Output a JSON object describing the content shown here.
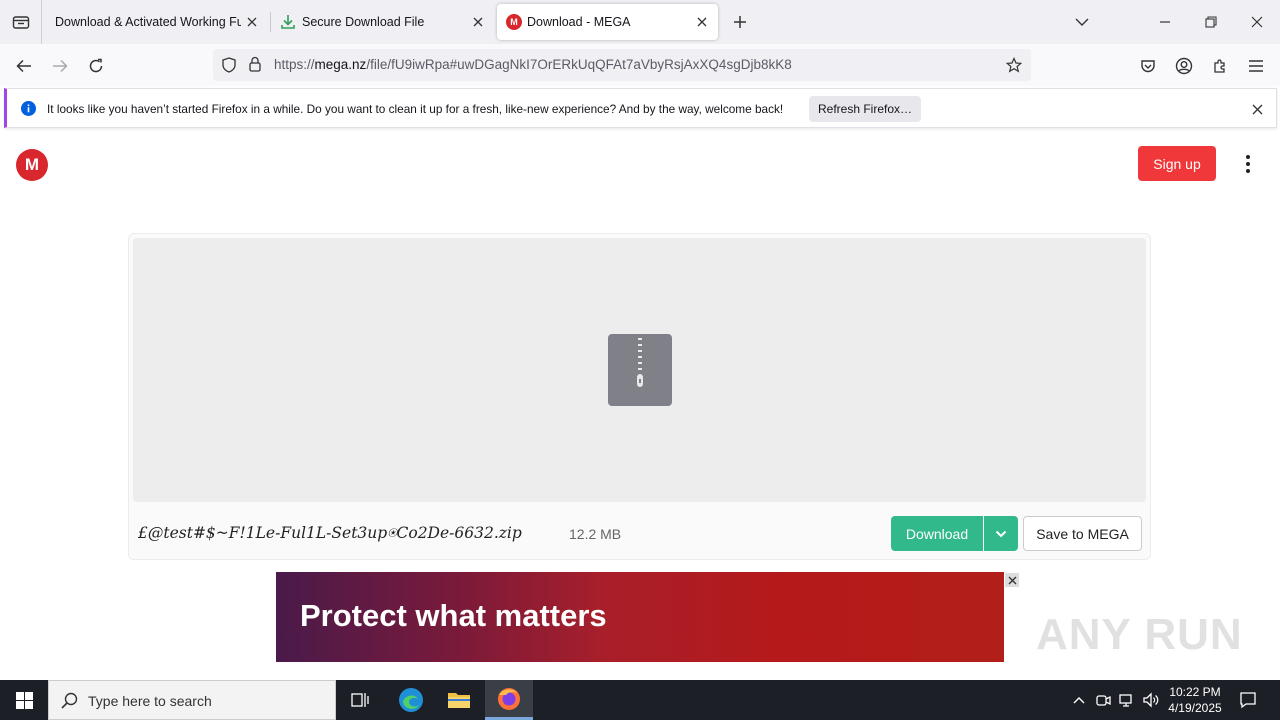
{
  "browser": {
    "tabs": [
      {
        "title": "Download & Activated Working Full"
      },
      {
        "title": "Secure Download File"
      },
      {
        "title": "Download - MEGA"
      }
    ],
    "url": {
      "prefix": "https://",
      "host": "mega.nz",
      "path": "/file/fU9iwRpa#uwDGagNkI7OrERkUqQFAt7aVbyRsjAxXQ4sgDjb8kK8"
    }
  },
  "notification": {
    "text": "It looks like you haven’t started Firefox in a while. Do you want to clean it up for a fresh, like-new experience? And by the way, welcome back!",
    "button": "Refresh Firefox…"
  },
  "page": {
    "logo_letter": "M",
    "signup_label": "Sign up",
    "file": {
      "name": "£@test#$~F!1Le-Ful1L-Set3up⍟Co2De-6632.zip",
      "size": "12.2 MB"
    },
    "download_label": "Download",
    "save_label": "Save to MEGA",
    "ad_text": "Protect what matters",
    "watermark": "ANY RUN"
  },
  "taskbar": {
    "search_placeholder": "Type here to search",
    "time": "10:22 PM",
    "date": "4/19/2025"
  },
  "colors": {
    "mega_red": "#d9272e",
    "signup": "#f0373a",
    "download_green": "#31b88b",
    "notif_accent": "#9f47e6"
  }
}
